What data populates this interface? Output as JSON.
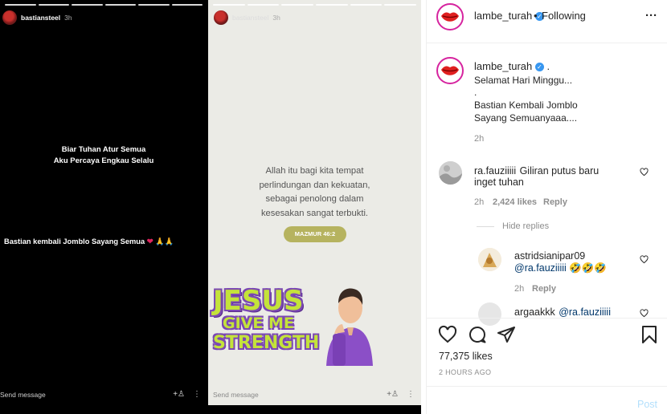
{
  "story1": {
    "username": "bastiansteel",
    "time": "3h",
    "line1": "Biar Tuhan Atur Semua",
    "line2": "Aku Percaya Engkau Selalu",
    "caption": "Bastian kembali Jomblo Sayang Semua",
    "send_message": "Send message"
  },
  "story2": {
    "username": "bastiansteel",
    "time": "3h",
    "verse": [
      "Allah itu bagi kita tempat",
      "perlindungan dan kekuatan,",
      "sebagai penolong dalam",
      "kesesakan sangat terbukti."
    ],
    "badge": "MAZMUR 46:2",
    "sticker": {
      "word1": "JESUS",
      "word2": "GIVE ME",
      "word3": "STRENGTH"
    },
    "send_message": "Send message"
  },
  "post": {
    "username": "lambe_turah",
    "follow_label": "Following",
    "dot": "•",
    "caption_suffix": ".",
    "caption_lines": [
      "Selamat Hari Minggu...",
      ".",
      "Bastian Kembali Jomblo",
      "Sayang Semuanyaaa...."
    ],
    "caption_time": "2h",
    "likes": "77,375 likes",
    "posted_ago": "2 HOURS AGO",
    "post_button": "Post"
  },
  "comments": [
    {
      "username": "ra.fauziiiii",
      "text_line1": "Giliran putus baru",
      "text_line2": "inget tuhan",
      "time": "2h",
      "likes": "2,424 likes",
      "reply": "Reply"
    },
    {
      "username": "astridsianipar09",
      "text": "@ra.fauziiiii 🤣🤣🤣",
      "time": "2h",
      "reply": "Reply"
    },
    {
      "username": "argaakkk",
      "text": "@ra.fauziiiii"
    }
  ],
  "hide_replies": "Hide replies",
  "colors": {
    "verified": "#3897f0",
    "sticker_green": "#c4e33a",
    "sticker_purple": "#7b48b3",
    "badge": "#b6b35f"
  }
}
